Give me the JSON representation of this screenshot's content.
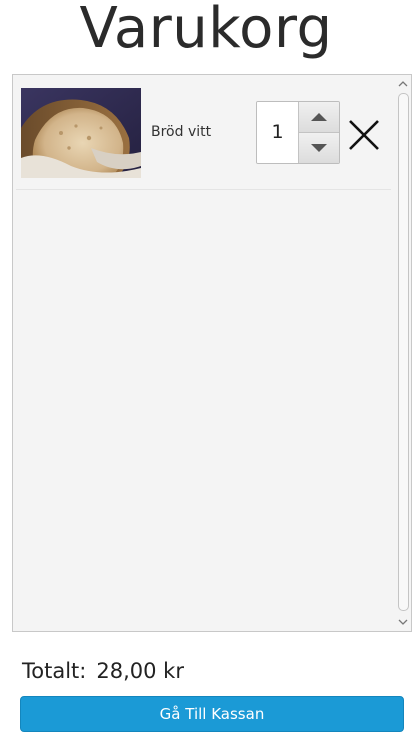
{
  "header": {
    "title": "Varukorg"
  },
  "cart": {
    "items": [
      {
        "name": "Bröd vitt",
        "quantity": "1",
        "image_icon": "bread-photo",
        "remove_icon": "close-icon"
      }
    ]
  },
  "footer": {
    "total_label": "Totalt:",
    "total_value": "28,00 kr",
    "checkout_label": "Gå Till Kassan"
  },
  "colors": {
    "accent": "#1b9ad6",
    "list_background": "#f4f4f4",
    "title_text": "#2b2b2b"
  }
}
